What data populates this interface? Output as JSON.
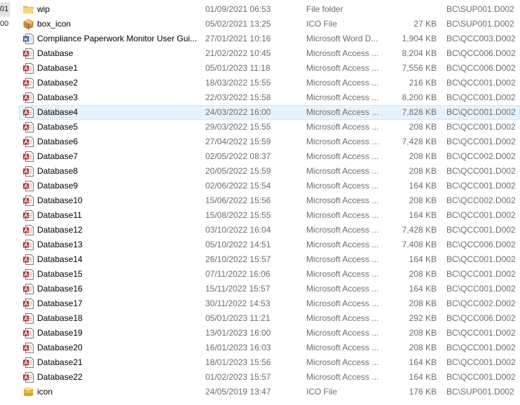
{
  "gutter": [
    "01",
    "00"
  ],
  "files": [
    {
      "icon": "folder-icon",
      "name": "wip",
      "date": "01/09/2021 06:53",
      "type": "File folder",
      "size": "",
      "owner": "BC\\SUP001.D002"
    },
    {
      "icon": "box-icon",
      "name": "box_icon",
      "date": "05/02/2021 13:25",
      "type": "ICO File",
      "size": "27 KB",
      "owner": "BC\\SUP001.D002"
    },
    {
      "icon": "word-doc-icon",
      "name": "Compliance Paperwork Monitor User Gui...",
      "date": "27/01/2021 10:16",
      "type": "Microsoft Word D...",
      "size": "1,904 KB",
      "owner": "BC\\QCC003.D002"
    },
    {
      "icon": "access-db-icon",
      "name": "Database",
      "date": "21/02/2022 10:45",
      "type": "Microsoft Access ...",
      "size": "8,204 KB",
      "owner": "BC\\QCC006.D002"
    },
    {
      "icon": "access-db-icon",
      "name": "Database1",
      "date": "05/01/2023 11:18",
      "type": "Microsoft Access ...",
      "size": "7,556 KB",
      "owner": "BC\\QCC006.D002"
    },
    {
      "icon": "access-db-icon",
      "name": "Database2",
      "date": "18/03/2022 15:55",
      "type": "Microsoft Access ...",
      "size": "216 KB",
      "owner": "BC\\QCC001.D002"
    },
    {
      "icon": "access-db-icon",
      "name": "Database3",
      "date": "22/03/2022 15:58",
      "type": "Microsoft Access ...",
      "size": "8,200 KB",
      "owner": "BC\\QCC001.D002"
    },
    {
      "icon": "access-db-icon",
      "name": "Database4",
      "date": "24/03/2022 16:00",
      "type": "Microsoft Access ...",
      "size": "7,828 KB",
      "owner": "BC\\QCC001.D002"
    },
    {
      "icon": "access-db-icon",
      "name": "Database5",
      "date": "29/03/2022 15:55",
      "type": "Microsoft Access ...",
      "size": "208 KB",
      "owner": "BC\\QCC001.D002"
    },
    {
      "icon": "access-db-icon",
      "name": "Database6",
      "date": "27/04/2022 15:59",
      "type": "Microsoft Access ...",
      "size": "7,428 KB",
      "owner": "BC\\QCC001.D002"
    },
    {
      "icon": "access-db-icon",
      "name": "Database7",
      "date": "02/05/2022 08:37",
      "type": "Microsoft Access ...",
      "size": "208 KB",
      "owner": "BC\\QCC002.D002"
    },
    {
      "icon": "access-db-icon",
      "name": "Database8",
      "date": "20/05/2022 15:59",
      "type": "Microsoft Access ...",
      "size": "208 KB",
      "owner": "BC\\QCC001.D002"
    },
    {
      "icon": "access-db-icon",
      "name": "Database9",
      "date": "02/06/2022 15:54",
      "type": "Microsoft Access ...",
      "size": "164 KB",
      "owner": "BC\\QCC001.D002"
    },
    {
      "icon": "access-db-icon",
      "name": "Database10",
      "date": "15/06/2022 15:56",
      "type": "Microsoft Access ...",
      "size": "208 KB",
      "owner": "BC\\QCC002.D002"
    },
    {
      "icon": "access-db-icon",
      "name": "Database11",
      "date": "15/08/2022 15:55",
      "type": "Microsoft Access ...",
      "size": "164 KB",
      "owner": "BC\\QCC001.D002"
    },
    {
      "icon": "access-db-icon",
      "name": "Database12",
      "date": "03/10/2022 16:04",
      "type": "Microsoft Access ...",
      "size": "7,428 KB",
      "owner": "BC\\QCC001.D002"
    },
    {
      "icon": "access-db-icon",
      "name": "Database13",
      "date": "05/10/2022 14:51",
      "type": "Microsoft Access ...",
      "size": "7,408 KB",
      "owner": "BC\\QCC006.D002"
    },
    {
      "icon": "access-db-icon",
      "name": "Database14",
      "date": "26/10/2022 15:57",
      "type": "Microsoft Access ...",
      "size": "164 KB",
      "owner": "BC\\QCC001.D002"
    },
    {
      "icon": "access-db-icon",
      "name": "Database15",
      "date": "07/11/2022 16:06",
      "type": "Microsoft Access ...",
      "size": "208 KB",
      "owner": "BC\\QCC001.D002"
    },
    {
      "icon": "access-db-icon",
      "name": "Database16",
      "date": "15/11/2022 15:57",
      "type": "Microsoft Access ...",
      "size": "164 KB",
      "owner": "BC\\QCC001.D002"
    },
    {
      "icon": "access-db-icon",
      "name": "Database17",
      "date": "30/11/2022 14:53",
      "type": "Microsoft Access ...",
      "size": "208 KB",
      "owner": "BC\\QCC002.D002"
    },
    {
      "icon": "access-db-icon",
      "name": "Database18",
      "date": "05/01/2023 11:21",
      "type": "Microsoft Access ...",
      "size": "292 KB",
      "owner": "BC\\QCC006.D002"
    },
    {
      "icon": "access-db-icon",
      "name": "Database19",
      "date": "13/01/2023 16:00",
      "type": "Microsoft Access ...",
      "size": "208 KB",
      "owner": "BC\\QCC001.D002"
    },
    {
      "icon": "access-db-icon",
      "name": "Database20",
      "date": "16/01/2023 16:03",
      "type": "Microsoft Access ...",
      "size": "208 KB",
      "owner": "BC\\QCC001.D002"
    },
    {
      "icon": "access-db-icon",
      "name": "Database21",
      "date": "18/01/2023 15:56",
      "type": "Microsoft Access ...",
      "size": "164 KB",
      "owner": "BC\\QCC001.D002"
    },
    {
      "icon": "access-db-icon",
      "name": "Database22",
      "date": "01/02/2023 15:57",
      "type": "Microsoft Access ...",
      "size": "164 KB",
      "owner": "BC\\QCC001.D002"
    },
    {
      "icon": "cylinder-icon",
      "name": "icon",
      "date": "24/05/2019 13:47",
      "type": "ICO File",
      "size": "176 KB",
      "owner": "BC\\SUP001.D002"
    }
  ],
  "hovered_index": 7
}
